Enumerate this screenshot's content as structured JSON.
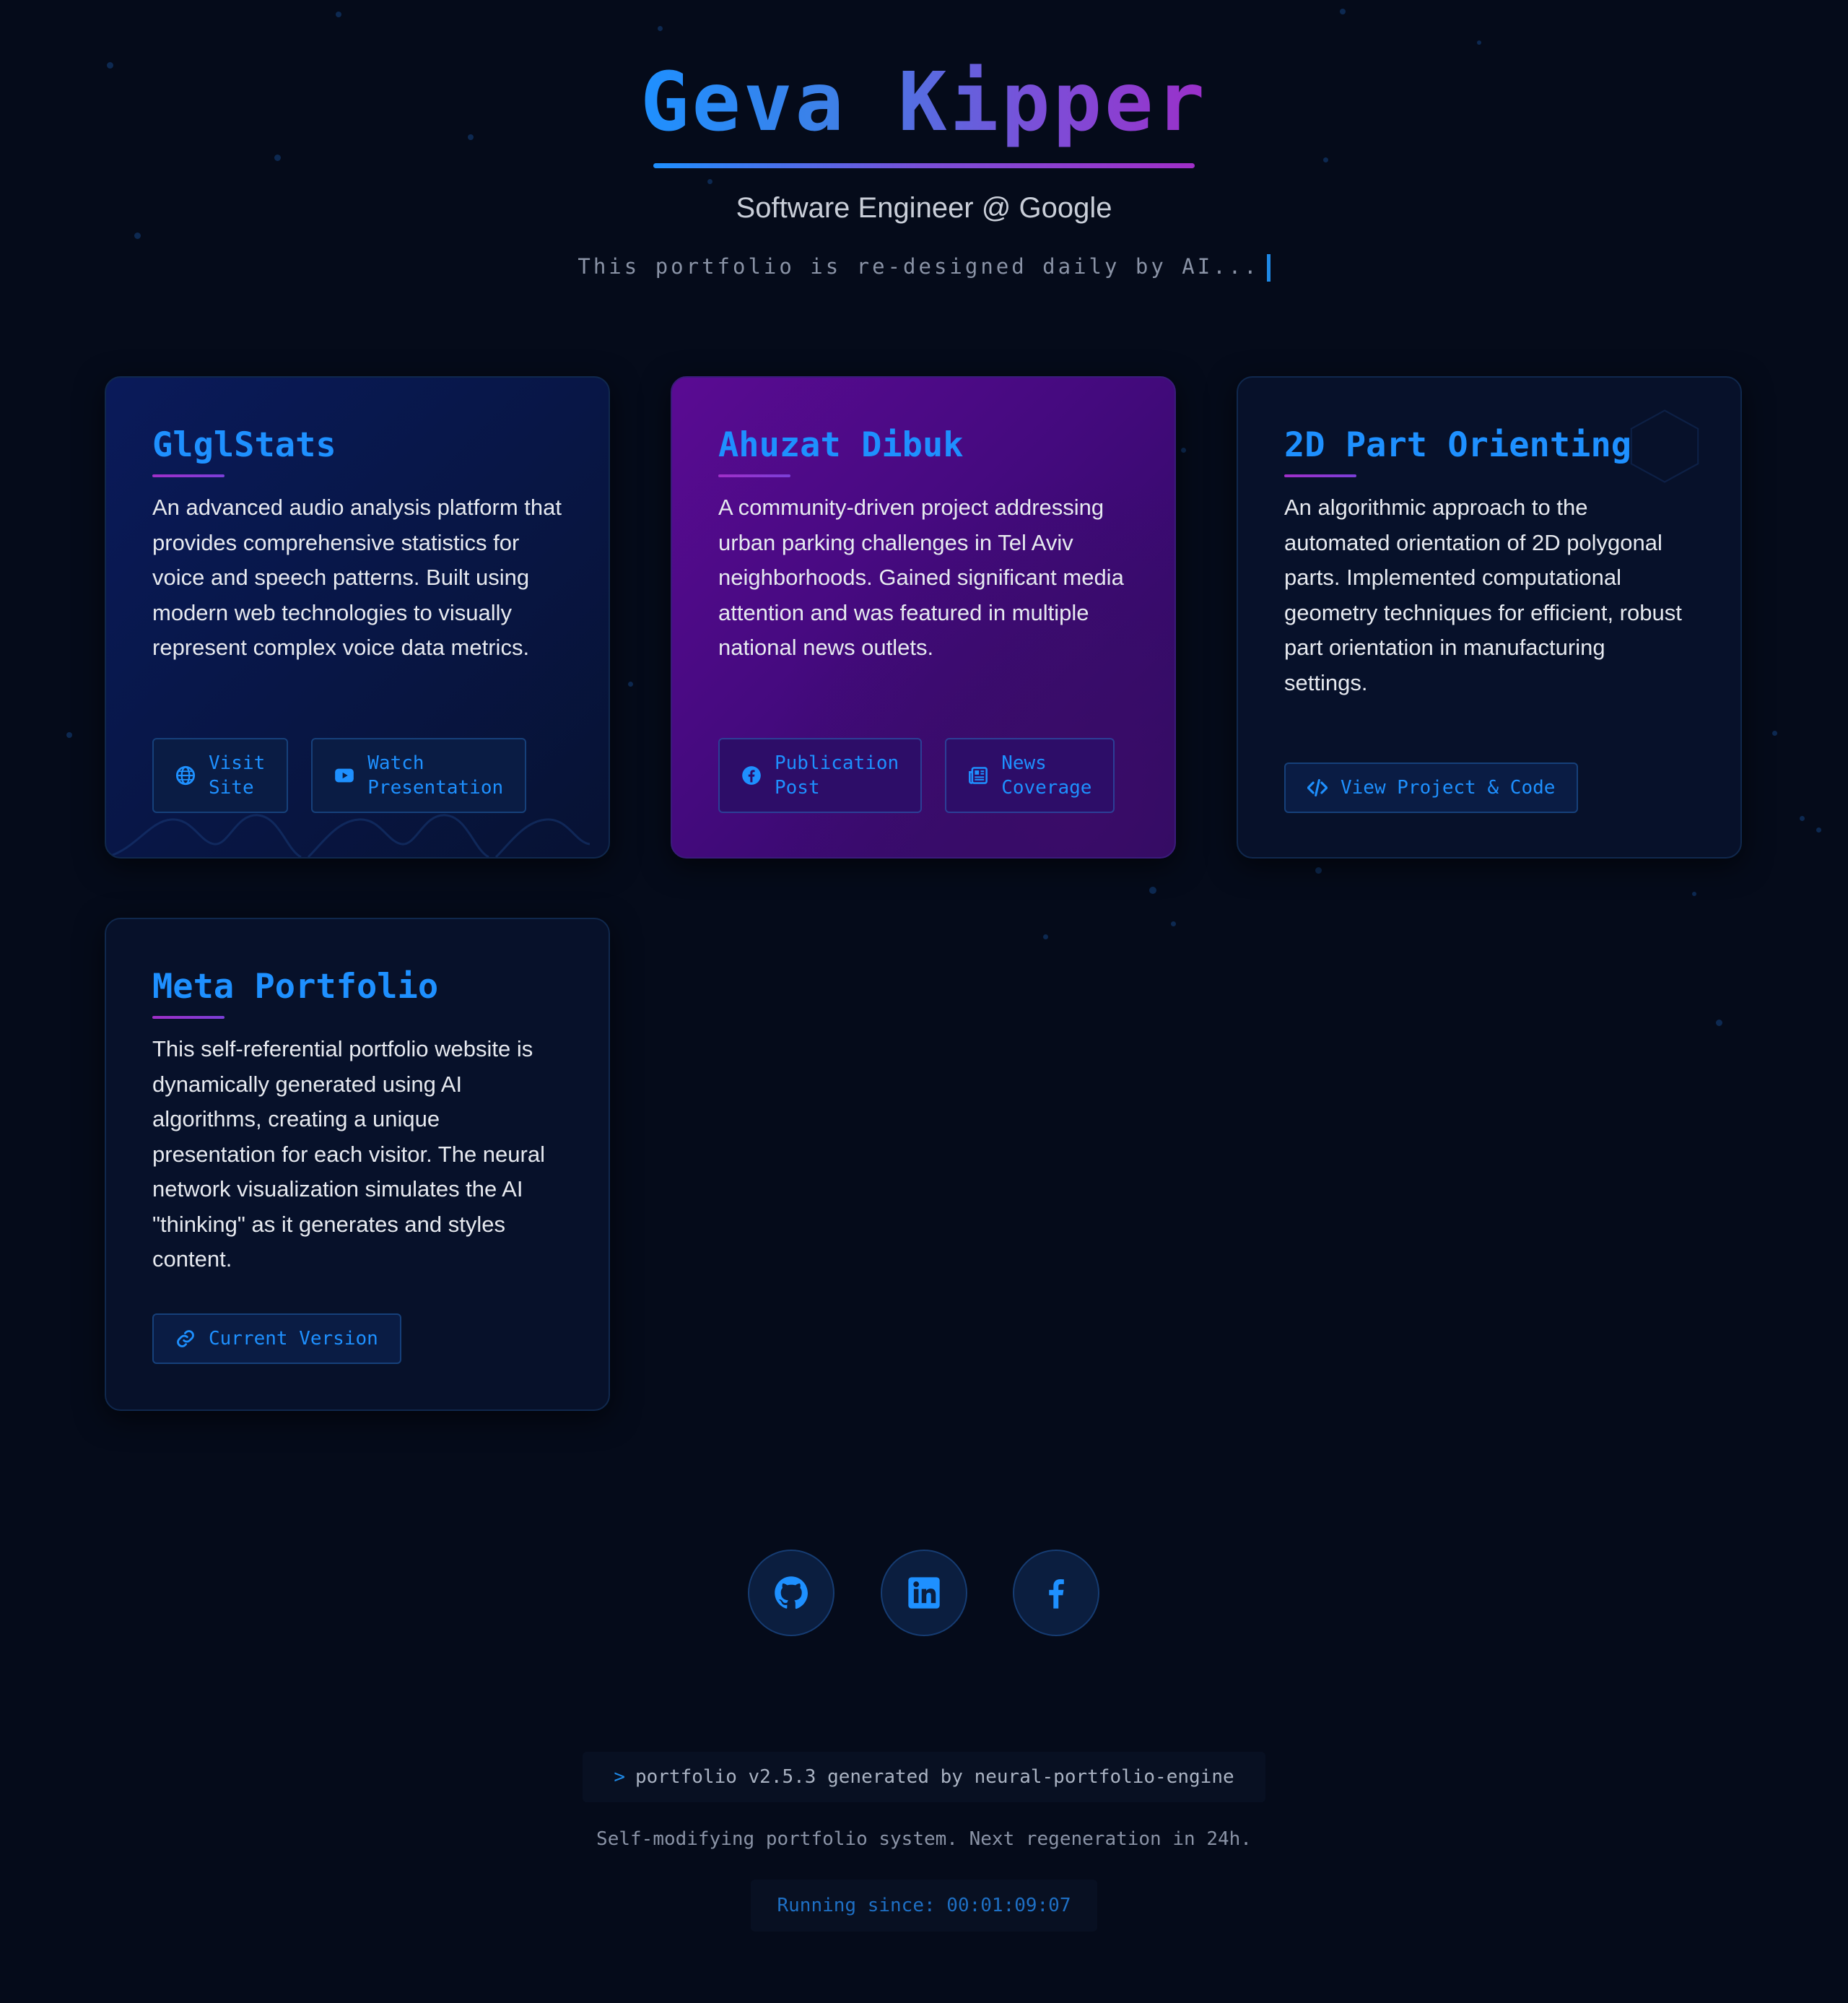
{
  "header": {
    "name": "Geva Kipper",
    "role": "Software Engineer @ Google",
    "tagline": "This portfolio is re-designed daily by AI..."
  },
  "projects": [
    {
      "title": "GlglStats",
      "description": "An advanced audio analysis platform that provides comprehensive statistics for voice and speech patterns. Built using modern web technologies to visually represent complex voice data metrics.",
      "buttons": [
        {
          "label": "Visit\nSite",
          "icon": "globe-icon"
        },
        {
          "label": "Watch\nPresentation",
          "icon": "youtube-icon"
        }
      ]
    },
    {
      "title": "Ahuzat Dibuk",
      "description": "A community-driven project addressing urban parking challenges in Tel Aviv neighborhoods. Gained significant media attention and was featured in multiple national news outlets.",
      "buttons": [
        {
          "label": "Publication\nPost",
          "icon": "facebook-icon"
        },
        {
          "label": "News\nCoverage",
          "icon": "newspaper-icon"
        }
      ]
    },
    {
      "title": "2D Part Orienting",
      "description": "An algorithmic approach to the automated orientation of 2D polygonal parts. Implemented computational geometry techniques for efficient, robust part orientation in manufacturing settings.",
      "buttons": [
        {
          "label": "View Project & Code",
          "icon": "code-icon"
        }
      ]
    },
    {
      "title": "Meta Portfolio",
      "description": "This self-referential portfolio website is dynamically generated using AI algorithms, creating a unique presentation for each visitor. The neural network visualization simulates the AI \"thinking\" as it generates and styles content.",
      "buttons": [
        {
          "label": "Current Version",
          "icon": "link-icon"
        }
      ]
    }
  ],
  "social": [
    {
      "name": "GitHub",
      "icon": "github-icon"
    },
    {
      "name": "LinkedIn",
      "icon": "linkedin-icon"
    },
    {
      "name": "Facebook",
      "icon": "facebook-icon"
    }
  ],
  "footer": {
    "prompt": ">",
    "command": "portfolio v2.5.3 generated by neural-portfolio-engine",
    "note": "Self-modifying portfolio system. Next regeneration in 24h.",
    "running": "Running since: 00:01:09:07"
  },
  "colors": {
    "background": "#050b1a",
    "accent": "#1e90ff",
    "purple": "#a02fc8"
  }
}
